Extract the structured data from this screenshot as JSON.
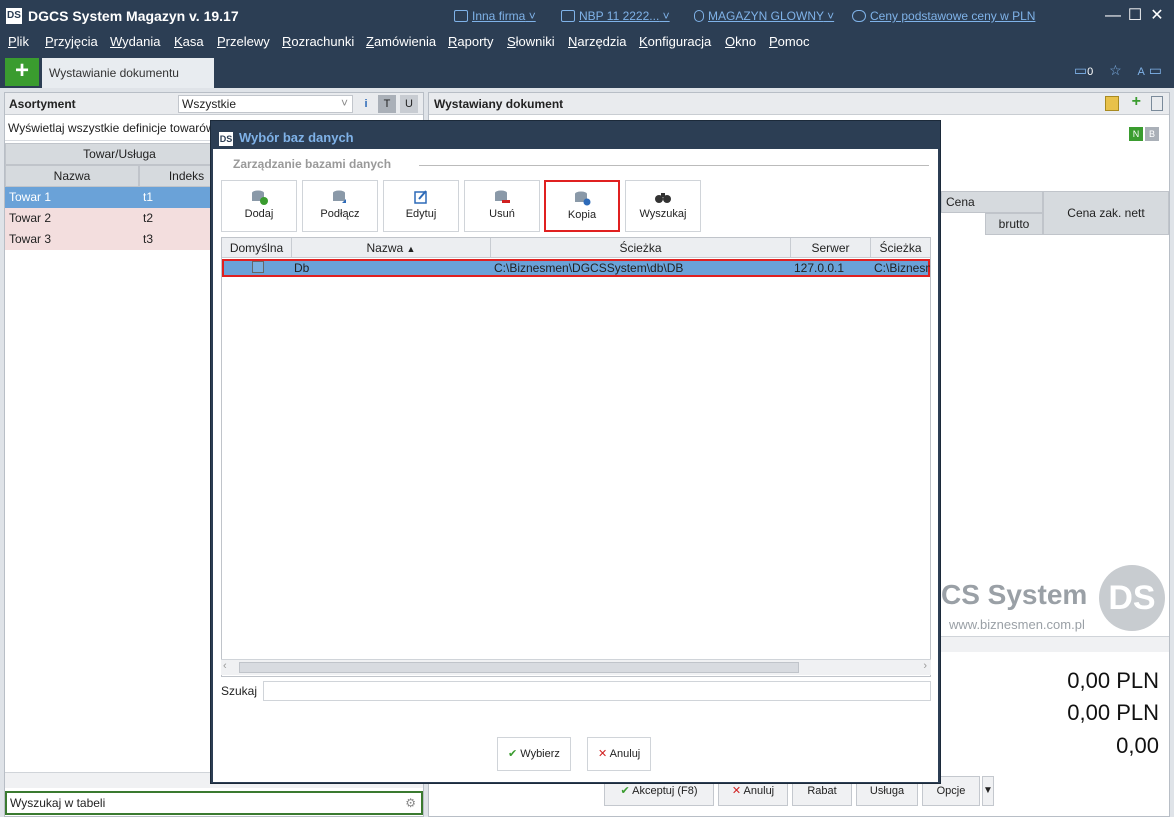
{
  "app": {
    "logo": "DS",
    "title": "DGCS System Magazyn v. 19.17",
    "company": "Inna firma",
    "rate": "NBP 11 2222...",
    "warehouse": "MAGAZYN GLOWNY",
    "prices": "Ceny podstawowe ceny w PLN"
  },
  "menu": [
    "Plik",
    "Przyjęcia",
    "Wydania",
    "Kasa",
    "Przelewy",
    "Rozrachunki",
    "Zamówienia",
    "Raporty",
    "Słowniki",
    "Narzędzia",
    "Konfiguracja",
    "Okno",
    "Pomoc"
  ],
  "tabs": {
    "add": "+",
    "doc": "Wystawianie dokumentu",
    "notifications": "0"
  },
  "left": {
    "title": "Asortyment",
    "filter": "Wszystkie",
    "desc": "Wyświetlaj wszystkie definicje towarów",
    "group_header": "Towar/Usługa",
    "col_name": "Nazwa",
    "col_index": "Indeks",
    "rows": [
      {
        "name": "Towar 1",
        "index": "t1"
      },
      {
        "name": "Towar 2",
        "index": "t2"
      },
      {
        "name": "Towar 3",
        "index": "t3"
      }
    ],
    "search_placeholder": "Wyszukaj w tabeli"
  },
  "right": {
    "title": "Wystawiany dokument",
    "col_cena": "Cena",
    "col_brutto": "brutto",
    "col_cena_zak": "Cena zak. nett",
    "brand": "CS System",
    "website": "www.biznesmen.com.pl",
    "total1": "0,00 PLN",
    "total2": "0,00 PLN",
    "total3": "0,00",
    "btn_accept": "Akceptuj (F8)",
    "btn_cancel": "Anuluj",
    "btn_rabat": "Rabat",
    "btn_usluga": "Usługa",
    "btn_opcje": "Opcje"
  },
  "modal": {
    "title": "Wybór baz danych",
    "group": "Zarządzanie bazami danych",
    "tools": [
      "Dodaj",
      "Podłącz",
      "Edytuj",
      "Usuń",
      "Kopia",
      "Wyszukaj"
    ],
    "columns": [
      "Domyślna",
      "Nazwa",
      "Ścieżka",
      "Serwer",
      "Ścieżka"
    ],
    "row": {
      "name": "Db",
      "path": "C:\\Biznesmen\\DGCSSystem\\db\\DB",
      "server": "127.0.0.1",
      "path2": "C:\\Biznesm"
    },
    "search_label": "Szukaj",
    "btn_ok": "Wybierz",
    "btn_cancel": "Anuluj"
  },
  "colors": {
    "accent": "#2c3e54",
    "link": "#7fb2e8",
    "selection": "#6aa2d8",
    "highlight": "#e02020",
    "green": "#3a9c2f"
  }
}
